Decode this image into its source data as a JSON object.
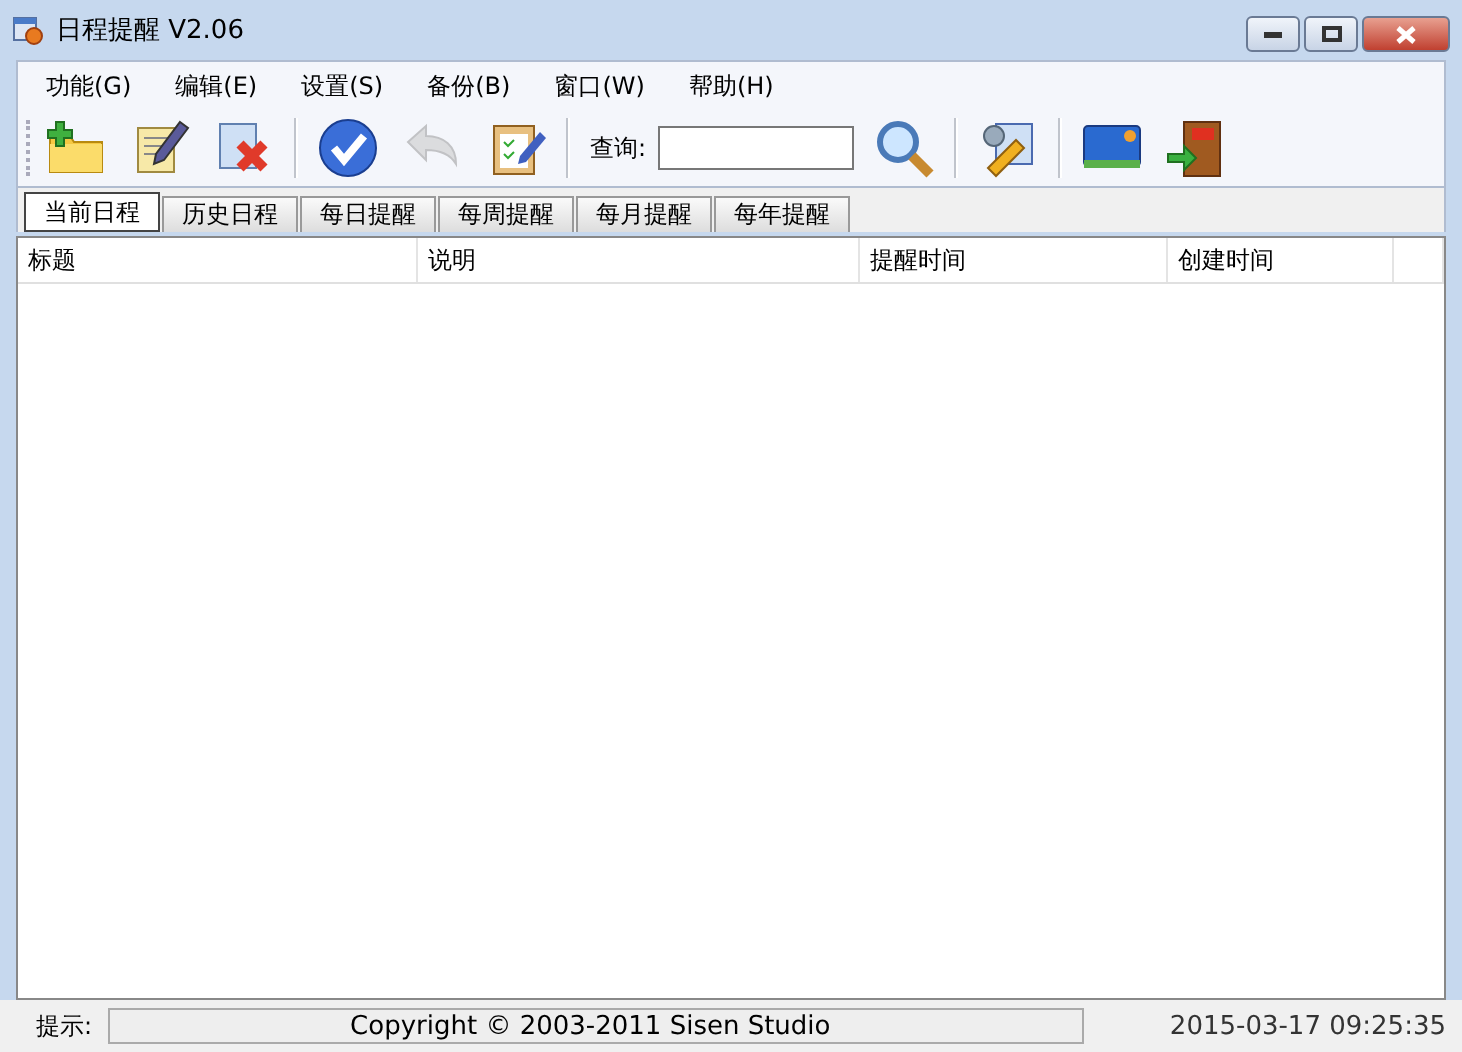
{
  "window": {
    "title": "日程提醒 V2.06"
  },
  "menu": [
    "功能(G)",
    "编辑(E)",
    "设置(S)",
    "备份(B)",
    "窗口(W)",
    "帮助(H)"
  ],
  "toolbar": [
    {
      "kind": "button",
      "disabled": false
    },
    {
      "kind": "button",
      "disabled": false
    },
    {
      "kind": "button",
      "disabled": false
    },
    {
      "kind": "separator"
    },
    {
      "kind": "button",
      "disabled": false
    },
    {
      "kind": "button",
      "disabled": true
    },
    {
      "kind": "button",
      "disabled": false
    },
    {
      "kind": "separator"
    },
    {
      "kind": "search",
      "label": "查询:"
    },
    {
      "kind": "button",
      "disabled": false
    },
    {
      "kind": "separator"
    },
    {
      "kind": "button",
      "disabled": false
    },
    {
      "kind": "separator"
    },
    {
      "kind": "button",
      "disabled": false
    },
    {
      "kind": "button",
      "disabled": false
    }
  ],
  "tabs": [
    {
      "label": "当前日程",
      "selected": true
    },
    {
      "label": "历史日程",
      "selected": false
    },
    {
      "label": "每日提醒",
      "selected": false
    },
    {
      "label": "每周提醒",
      "selected": false
    },
    {
      "label": "每月提醒",
      "selected": false
    },
    {
      "label": "每年提醒",
      "selected": false
    }
  ],
  "table": {
    "columns": [
      "标题",
      "说明",
      "提醒时间",
      "创建时间"
    ]
  },
  "status_bar": {
    "label": "提示:",
    "message": "Copyright © 2003-2011 Sisen Studio",
    "time": "2015-03-17 09:25:35"
  }
}
